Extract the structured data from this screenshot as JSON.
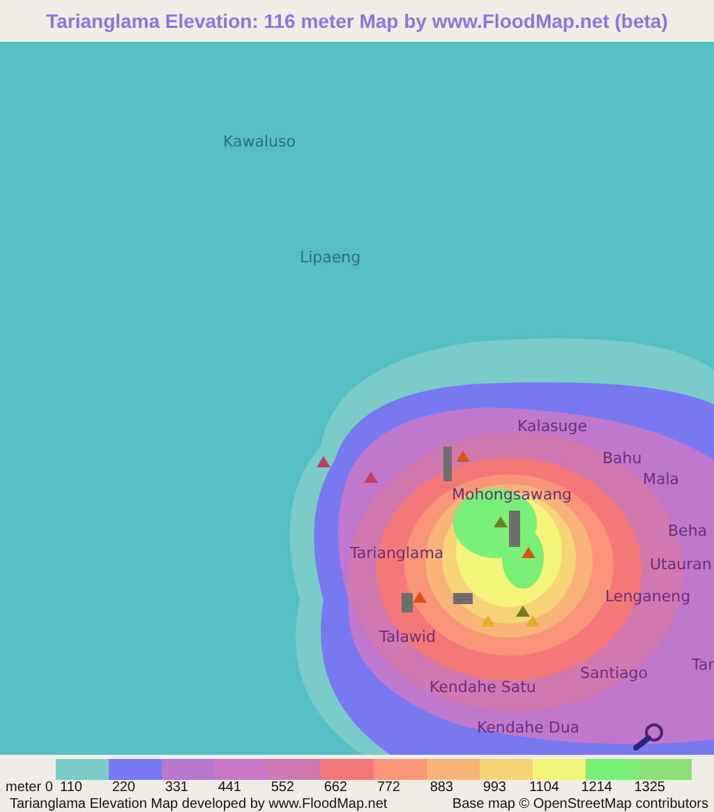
{
  "title": "Tarianglama Elevation: 116 meter Map by www.FloodMap.net (beta)",
  "map": {
    "places": [
      {
        "name": "Kawaluso"
      },
      {
        "name": "Lipaeng"
      },
      {
        "name": "Kalasuge"
      },
      {
        "name": "Bahu"
      },
      {
        "name": "Mala"
      },
      {
        "name": "Mohongsawang"
      },
      {
        "name": "Beha"
      },
      {
        "name": "Tarianglama"
      },
      {
        "name": "Utauran"
      },
      {
        "name": "Lenganeng"
      },
      {
        "name": "Talawid"
      },
      {
        "name": "Tar"
      },
      {
        "name": "Santiago"
      },
      {
        "name": "Kendahe Satu"
      },
      {
        "name": "Kendahe Dua"
      }
    ]
  },
  "legend": {
    "unit_label": "meter 0",
    "swatches": [
      {
        "color": "#7accc8"
      },
      {
        "color": "#7878f0"
      },
      {
        "color": "#b878d0"
      },
      {
        "color": "#cc78c8"
      },
      {
        "color": "#d078b0"
      },
      {
        "color": "#f47878"
      },
      {
        "color": "#f89478"
      },
      {
        "color": "#f8b478"
      },
      {
        "color": "#f8d478"
      },
      {
        "color": "#f4f478"
      },
      {
        "color": "#78f078"
      },
      {
        "color": "#8ce078"
      }
    ],
    "ticks": [
      "110",
      "220",
      "331",
      "441",
      "552",
      "662",
      "772",
      "883",
      "993",
      "1104",
      "1214",
      "1325"
    ]
  },
  "footer": {
    "credit": "Tarianglama Elevation Map developed by www.FloodMap.net",
    "attribution": "Base map © OpenStreetMap contributors"
  }
}
